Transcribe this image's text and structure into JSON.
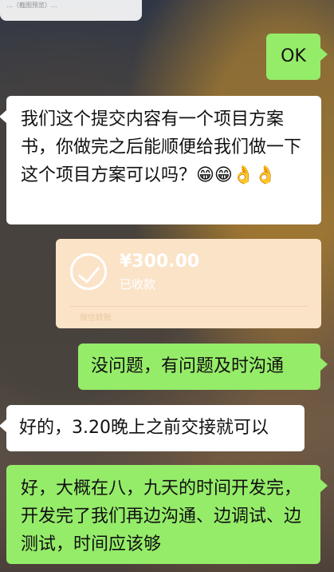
{
  "chat": {
    "top_snippet": "…（截图预览）…",
    "messages": [
      {
        "id": "m1",
        "side": "outgoing",
        "text": "OK"
      },
      {
        "id": "m2",
        "side": "incoming",
        "text": "我们这个提交内容有一个项目方案书，你做完之后能顺便给我们做一下这个项目方案可以吗？😁😁👌👌"
      },
      {
        "id": "m3",
        "side": "incoming",
        "type": "transfer",
        "amount": "¥300.00",
        "status": "已收款",
        "brand": "微信转账"
      },
      {
        "id": "m4",
        "side": "outgoing",
        "text": "没问题，有问题及时沟通"
      },
      {
        "id": "m5",
        "side": "incoming",
        "text": "好的，3.20晚上之前交接就可以"
      },
      {
        "id": "m6",
        "side": "outgoing",
        "text": "好，大概在八，九天的时间开发完，开发完了我们再边沟通、边调试、边测试，时间应该够"
      }
    ]
  },
  "colors": {
    "incoming_bubble": "#ffffff",
    "outgoing_bubble": "#95ec69",
    "transfer_card": "#fbe3c8"
  },
  "icons": {
    "transfer_status": "check-circle-icon"
  }
}
